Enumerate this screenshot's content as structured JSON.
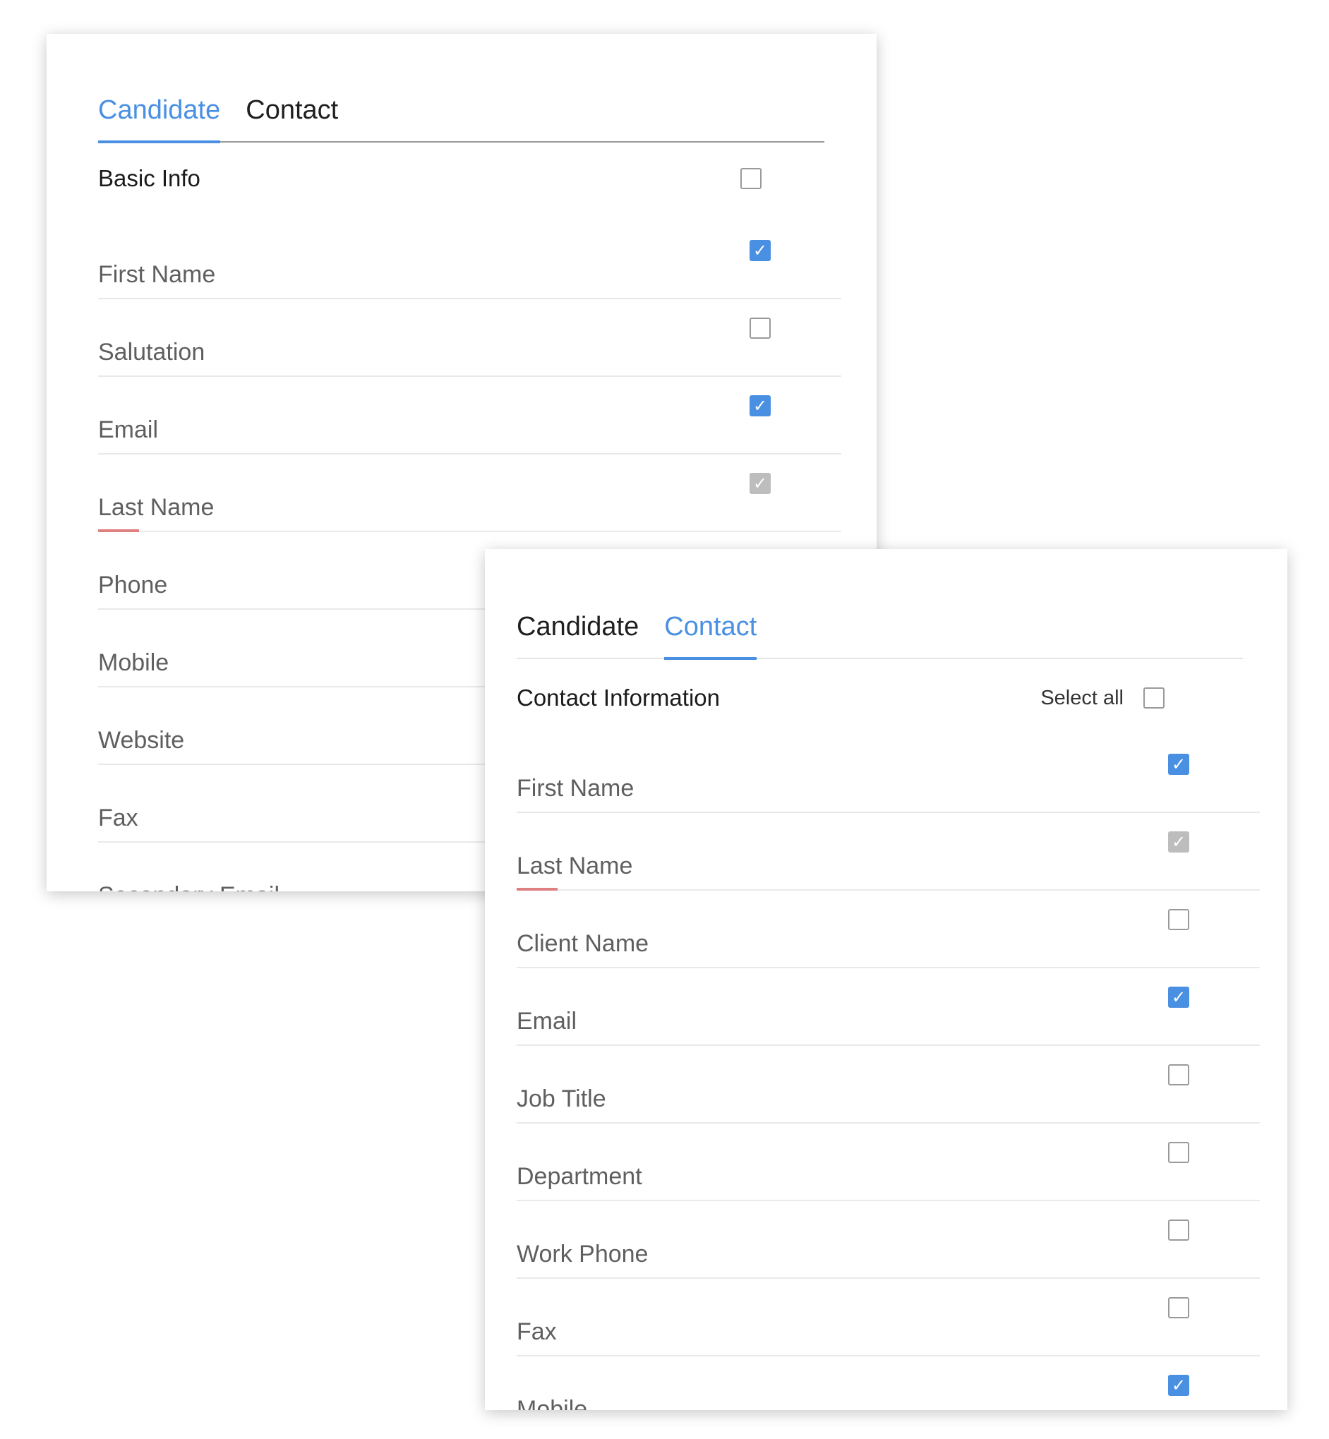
{
  "back_panel": {
    "tabs": [
      {
        "label": "Candidate",
        "active": true
      },
      {
        "label": "Contact",
        "active": false
      }
    ],
    "section_title": "Basic Info",
    "section_checkbox": "unchecked",
    "rows": [
      {
        "label": "First Name",
        "state": "checked",
        "mandatory": false
      },
      {
        "label": "Salutation",
        "state": "unchecked",
        "mandatory": false
      },
      {
        "label": "Email",
        "state": "checked",
        "mandatory": false
      },
      {
        "label": "Last Name",
        "state": "disabled",
        "mandatory": true
      },
      {
        "label": "Phone",
        "state": "unchecked",
        "mandatory": false
      },
      {
        "label": "Mobile",
        "state": "unchecked",
        "mandatory": false
      },
      {
        "label": "Website",
        "state": "unchecked",
        "mandatory": false
      },
      {
        "label": "Fax",
        "state": "unchecked",
        "mandatory": false
      },
      {
        "label": "Secondary Email",
        "state": "unchecked",
        "mandatory": false
      }
    ]
  },
  "front_panel": {
    "tabs": [
      {
        "label": "Candidate",
        "active": false
      },
      {
        "label": "Contact",
        "active": true
      }
    ],
    "section_title": "Contact Information",
    "select_all_label": "Select all",
    "section_checkbox": "unchecked",
    "rows": [
      {
        "label": "First Name",
        "state": "checked",
        "mandatory": false
      },
      {
        "label": "Last Name",
        "state": "disabled",
        "mandatory": true
      },
      {
        "label": "Client Name",
        "state": "unchecked",
        "mandatory": false
      },
      {
        "label": "Email",
        "state": "checked",
        "mandatory": false
      },
      {
        "label": "Job Title",
        "state": "unchecked",
        "mandatory": false
      },
      {
        "label": "Department",
        "state": "unchecked",
        "mandatory": false
      },
      {
        "label": "Work Phone",
        "state": "unchecked",
        "mandatory": false
      },
      {
        "label": "Fax",
        "state": "unchecked",
        "mandatory": false
      },
      {
        "label": "Mobile",
        "state": "checked",
        "mandatory": false
      }
    ]
  },
  "icons": {
    "check": "checkmark-icon"
  },
  "colors": {
    "accent": "#4a90e2",
    "mandatory": "#e07f7f",
    "disabled_checkbox": "#bdbdbd"
  }
}
